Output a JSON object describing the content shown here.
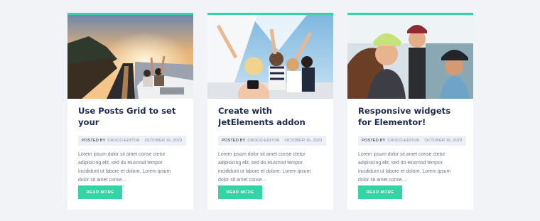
{
  "cards": [
    {
      "title": "Use Posts Grid to set your",
      "posted_by": "POSTED BY",
      "author": "CROCO-EDITOR",
      "date": "OCTOBER 16, 2023",
      "excerpt": "Lorem ipsum dolor sit amet conse ctetur adipisicing elit, sed do eiusmod tempor incididunt ut labore et dolore. Lorem ipsum dolor sit amet conse...",
      "button": "READ MORE"
    },
    {
      "title": "Create with JetElements addon",
      "posted_by": "POSTED BY",
      "author": "CROCO-EDITOR",
      "date": "OCTOBER 16, 2023",
      "excerpt": "Lorem ipsum dolor sit amet conse ctetur adipisicing elit, sed do eiusmod tempor incididunt ut labore et dolore. Lorem ipsum dolor sit amet conse...",
      "button": "READ MORE"
    },
    {
      "title": "Responsive widgets for Elementor!",
      "posted_by": "POSTED BY",
      "author": "CROCO-EDITOR",
      "date": "OCTOBER 16, 2023",
      "excerpt": "Lorem ipsum dolor sit amet conse ctetur adipisicing elit, sed do eiusmod tempor incididunt ut labore et dolore. Lorem ipsum dolor sit amet conse....",
      "button": "READ MORE"
    }
  ],
  "colors": {
    "accent": "#35d4a4",
    "title": "#1f2b4d",
    "meta_link": "#7c86c4",
    "background": "#f2f3f6"
  }
}
